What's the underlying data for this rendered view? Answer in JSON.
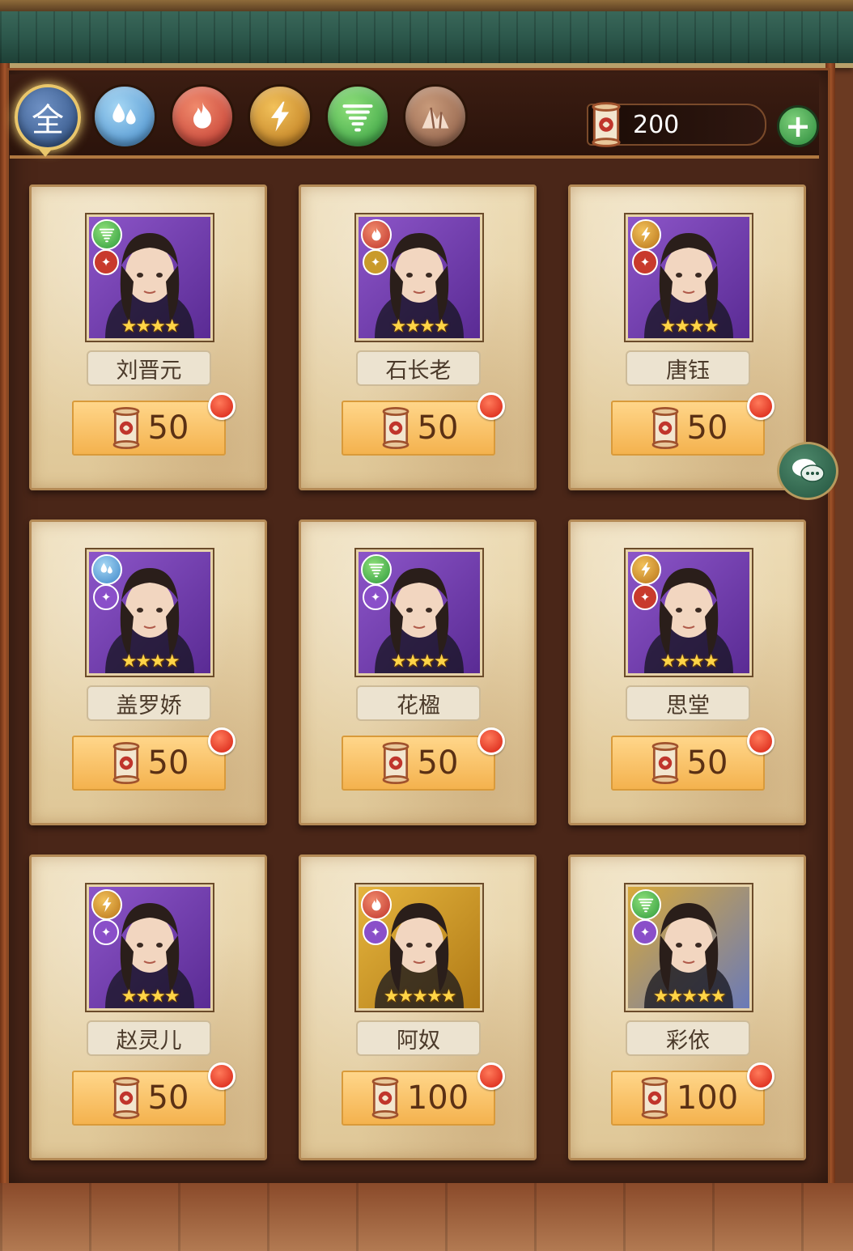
{
  "filters": {
    "all_label": "全",
    "items": [
      {
        "id": "all",
        "icon": "all-text-icon"
      },
      {
        "id": "water",
        "icon": "water-drops-icon"
      },
      {
        "id": "fire",
        "icon": "flame-icon"
      },
      {
        "id": "thunder",
        "icon": "lightning-icon"
      },
      {
        "id": "wind",
        "icon": "tornado-icon"
      },
      {
        "id": "earth",
        "icon": "rock-icon"
      }
    ]
  },
  "currency": {
    "icon": "scroll-icon",
    "value": "200",
    "add_label": "+"
  },
  "chat": {
    "icon": "chat-bubbles-icon"
  },
  "heroes": [
    {
      "name": "刘晋元",
      "price": "50",
      "element": "wind",
      "stars": "★★★★",
      "frame": "purple",
      "role_color": "red"
    },
    {
      "name": "石长老",
      "price": "50",
      "element": "fire",
      "stars": "★★★★",
      "frame": "purple",
      "role_color": "gold"
    },
    {
      "name": "唐钰",
      "price": "50",
      "element": "thunder",
      "stars": "★★★★",
      "frame": "purple",
      "role_color": "red"
    },
    {
      "name": "盖罗娇",
      "price": "50",
      "element": "water",
      "stars": "★★★★",
      "frame": "purple",
      "role_color": "purple"
    },
    {
      "name": "花楹",
      "price": "50",
      "element": "wind",
      "stars": "★★★★",
      "frame": "purple",
      "role_color": "purple"
    },
    {
      "name": "思堂",
      "price": "50",
      "element": "thunder",
      "stars": "★★★★",
      "frame": "purple",
      "role_color": "red"
    },
    {
      "name": "赵灵儿",
      "price": "50",
      "element": "thunder",
      "stars": "★★★★",
      "frame": "purple",
      "role_color": "purple"
    },
    {
      "name": "阿奴",
      "price": "100",
      "element": "fire",
      "stars": "★★★★★",
      "frame": "gold",
      "role_color": "purple"
    },
    {
      "name": "彩依",
      "price": "100",
      "element": "wind",
      "stars": "★★★★★",
      "frame": "gold-fancy",
      "role_color": "purple"
    }
  ],
  "colors": {
    "water": "#3d86c8",
    "fire": "#c0352c",
    "thunder": "#b77318",
    "wind": "#2e9a3c",
    "earth": "#8a5a44",
    "price_button": "#f4b24e",
    "notification_dot": "#d61f12"
  }
}
